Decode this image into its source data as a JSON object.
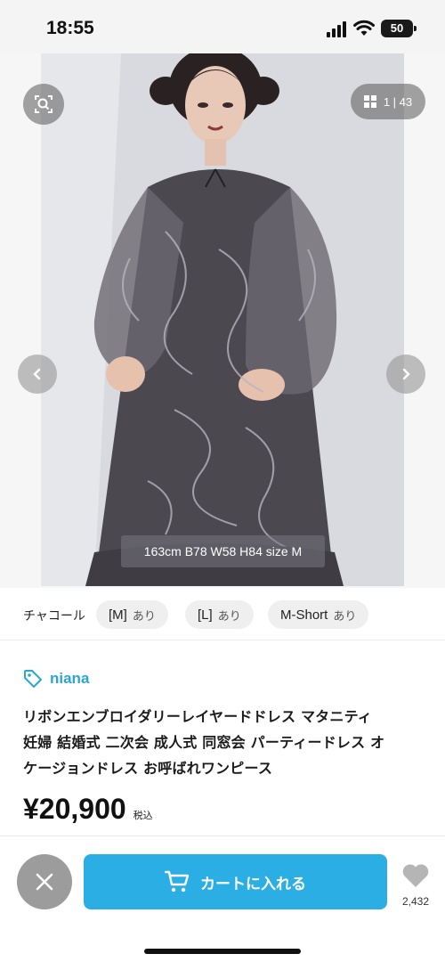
{
  "status_bar": {
    "time": "18:55",
    "battery": "50"
  },
  "gallery": {
    "counter": "1 | 43",
    "model_info": "163cm B78 W58 H84 size M"
  },
  "variants": {
    "color": "チャコール",
    "sizes": [
      {
        "size": "[M]",
        "availability": "あり"
      },
      {
        "size": "[L]",
        "availability": "あり"
      },
      {
        "size": "M-Short",
        "availability": "あり"
      }
    ]
  },
  "product": {
    "brand": "niana",
    "title_lines": [
      "リボンエンブロイダリーレイヤードドレス マタニティ",
      "妊婦 結婚式 二次会 成人式 同窓会 パーティードレス オ",
      "ケージョンドレス お呼ばれワンピース"
    ],
    "price": "¥20,900",
    "tax_label": "税込"
  },
  "actions": {
    "cart_label": "カートに入れる",
    "favorite_count": "2,432"
  },
  "colors": {
    "accent": "#2aaee3",
    "brand": "#2aa6d6"
  }
}
